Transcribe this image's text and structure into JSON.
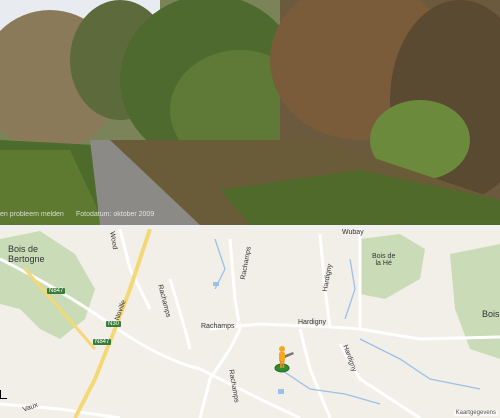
{
  "streetview": {
    "report_link": "en probleem melden",
    "photo_date": "Fotodatum: oktober 2009"
  },
  "map": {
    "labels": {
      "bois_de_bertogne": "Bois de\nBertogne",
      "bois_de_la_he": "Bois de\nla Hé",
      "bois": "Bois",
      "wubay": "Wubay",
      "rachamps_village": "Rachamps",
      "hardigny_village": "Hardigny",
      "rachamps_road_1": "Rachamps",
      "rachamps_road_2": "Rachamps",
      "rachamps_road_3": "Rachamps",
      "hardigny_road_1": "Hardigny",
      "hardigny_road_2": "Hardigny",
      "noville_road": "Noville",
      "wood_road": "Wood",
      "vaux_road": "Vaux"
    },
    "shields": {
      "n847_top": "N847",
      "n30": "N30",
      "n847_bottom": "N847"
    },
    "attribution": "Kaartgegevens"
  }
}
